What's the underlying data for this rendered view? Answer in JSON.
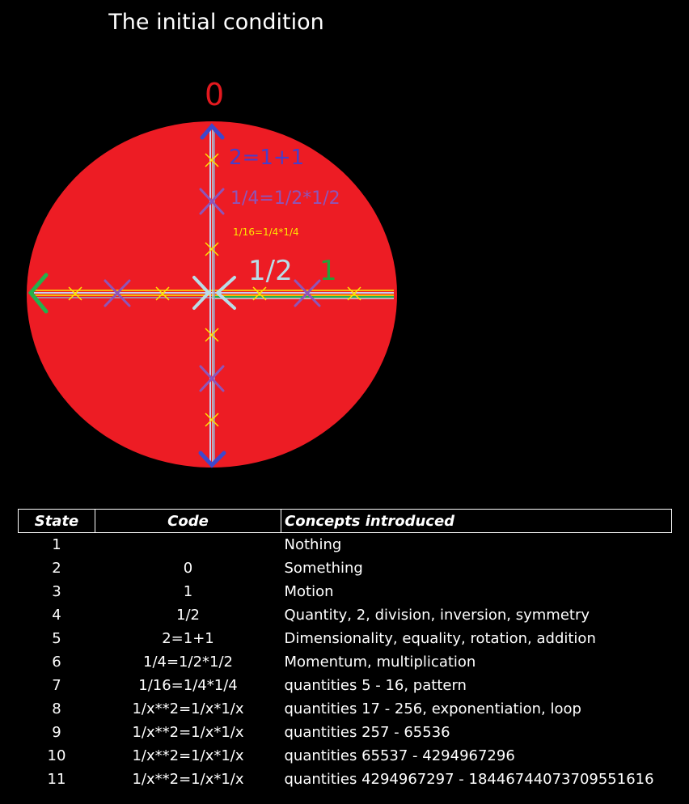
{
  "title": "The initial condition",
  "diagram": {
    "labels": {
      "zero": "0",
      "one": "1",
      "half": "1/2",
      "two": "2=1+1",
      "quarter": "1/4=1/2*1/2",
      "sixteenth": "1/16=1/4*1/4"
    },
    "colors": {
      "circle": "#ed1c24",
      "zero": "#e3191f",
      "one": "#22a33a",
      "half": "#b8dde8",
      "two": "#4a3ec8",
      "quarter": "#8e55b8",
      "sixteenth": "#ffe600",
      "arrow_up_down": "#3f48cc",
      "arrow_left": "#22b14c",
      "axis": "#c8d0f0"
    }
  },
  "table": {
    "headers": [
      "State",
      "Code",
      "Concepts introduced"
    ],
    "rows": [
      {
        "state": "1",
        "code": "",
        "concepts": "Nothing"
      },
      {
        "state": "2",
        "code": "0",
        "concepts": "Something"
      },
      {
        "state": "3",
        "code": "1",
        "concepts": "Motion"
      },
      {
        "state": "4",
        "code": "1/2",
        "concepts": "Quantity, 2, division, inversion, symmetry"
      },
      {
        "state": "5",
        "code": "2=1+1",
        "concepts": "Dimensionality, equality, rotation, addition"
      },
      {
        "state": "6",
        "code": "1/4=1/2*1/2",
        "concepts": "Momentum, multiplication"
      },
      {
        "state": "7",
        "code": "1/16=1/4*1/4",
        "concepts": "quantities 5 - 16, pattern"
      },
      {
        "state": "8",
        "code": "1/x**2=1/x*1/x",
        "concepts": "quantities 17 - 256, exponentiation, loop"
      },
      {
        "state": "9",
        "code": "1/x**2=1/x*1/x",
        "concepts": "quantities 257 - 65536"
      },
      {
        "state": "10",
        "code": "1/x**2=1/x*1/x",
        "concepts": "quantities 65537 - 4294967296"
      },
      {
        "state": "11",
        "code": "1/x**2=1/x*1/x",
        "concepts": "quantities 4294967297 - 18446744073709551616"
      }
    ]
  }
}
